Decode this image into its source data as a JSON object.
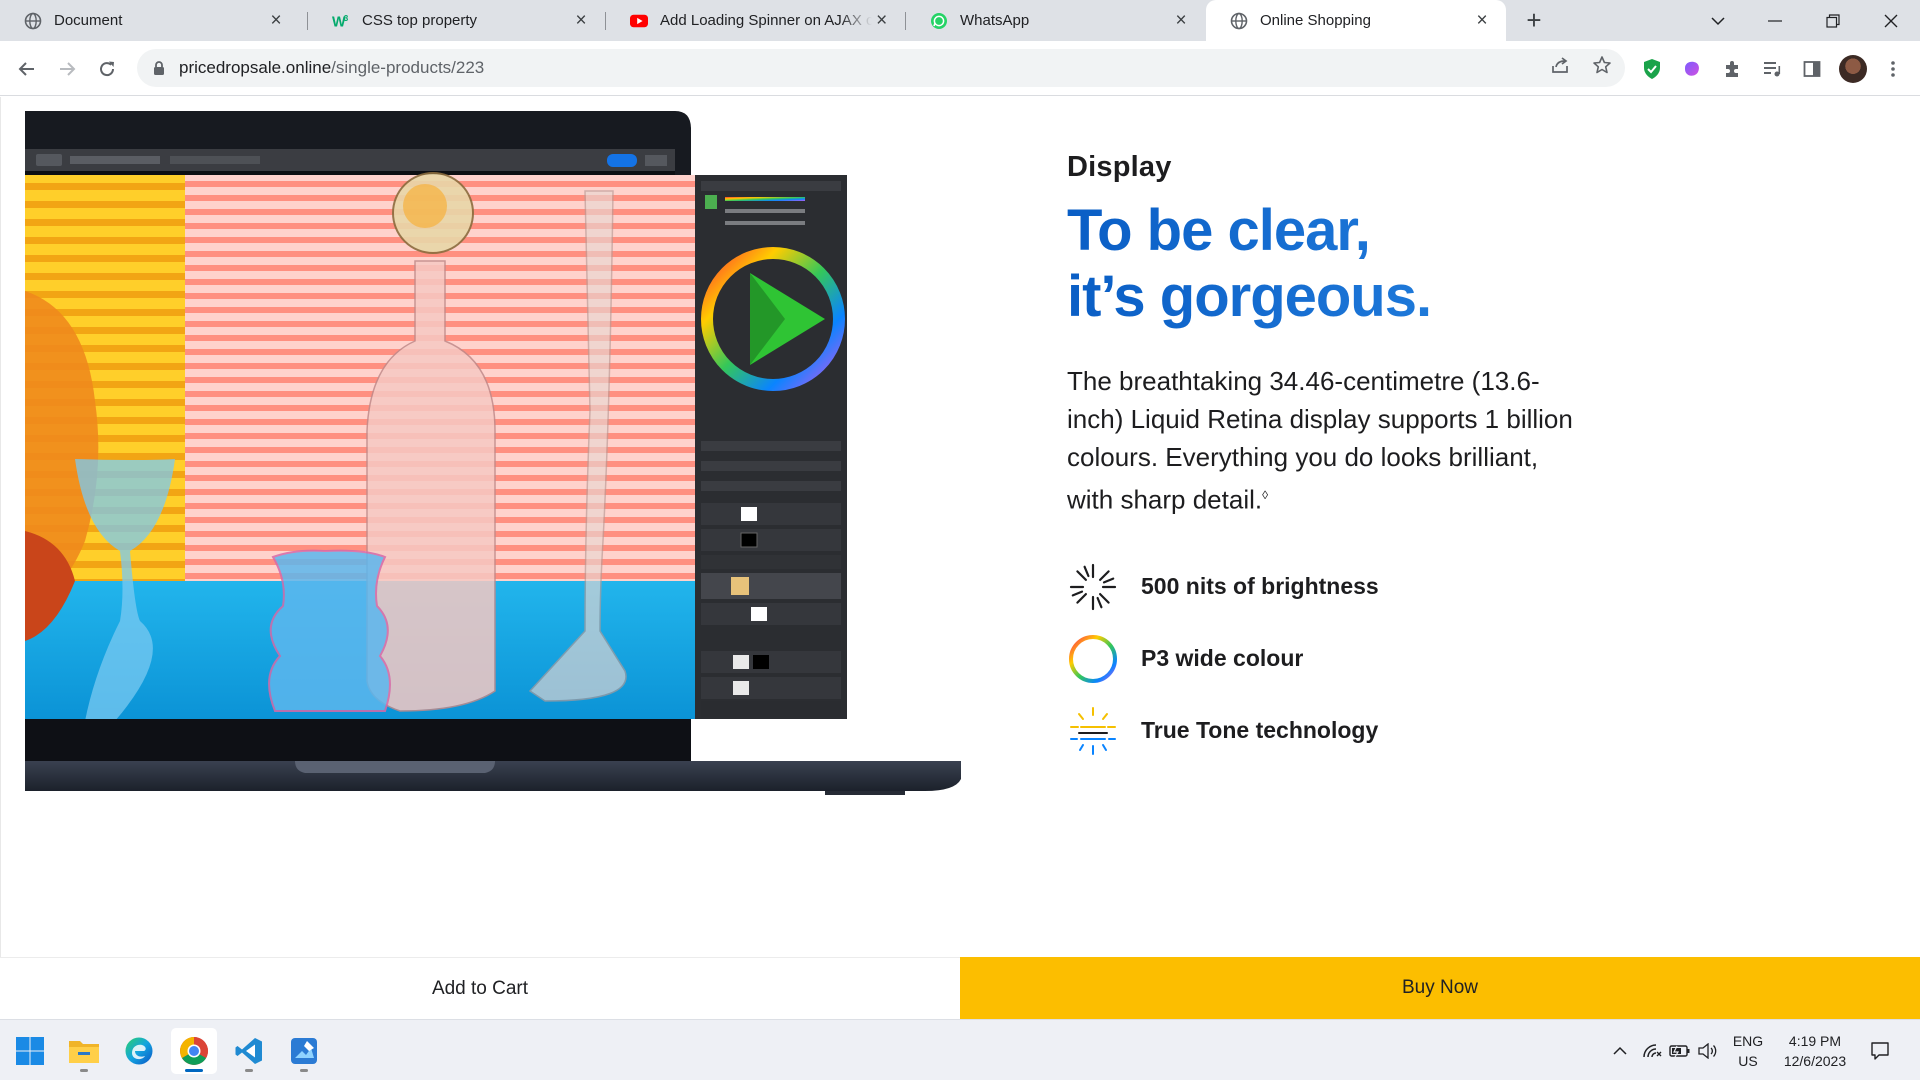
{
  "browser": {
    "tabs": [
      {
        "title": "Document",
        "icon": "globe-icon"
      },
      {
        "title": "CSS top property",
        "icon": "w3schools-icon"
      },
      {
        "title": "Add Loading Spinner on AJAX call",
        "icon": "youtube-icon"
      },
      {
        "title": "WhatsApp",
        "icon": "whatsapp-icon"
      },
      {
        "title": "Online Shopping",
        "icon": "globe-icon",
        "active": true
      }
    ],
    "url_domain": "pricedropsale.online",
    "url_path": "/single-products/223"
  },
  "product": {
    "eyebrow": "Display",
    "headline_line1": "To be clear,",
    "headline_line2": "it’s gorgeous.",
    "description": "The breathtaking 34.46-centimetre (13.6-inch) Liquid Retina display supports 1 billion colours. Everything you do looks brilliant, with sharp detail.",
    "description_mark": "◊",
    "features": [
      {
        "label": "500 nits of brightness",
        "icon": "brightness-icon"
      },
      {
        "label": "P3 wide colour",
        "icon": "color-ring-icon"
      },
      {
        "label": "True Tone technology",
        "icon": "true-tone-icon"
      }
    ],
    "image_icon": "macbook-display-image"
  },
  "actions": {
    "add_to_cart": "Add to Cart",
    "buy_now": "Buy Now"
  },
  "taskbar": {
    "apps": [
      "windows-start-icon",
      "file-explorer-icon",
      "edge-icon",
      "chrome-icon",
      "vscode-icon",
      "paint-icon"
    ],
    "language_line1": "ENG",
    "language_line2": "US",
    "time": "4:19 PM",
    "date": "12/6/2023"
  },
  "colors": {
    "accent_blue": "#0a5ec5",
    "buy_yellow": "#fcbe00",
    "tab_strip": "#dee1e6"
  }
}
